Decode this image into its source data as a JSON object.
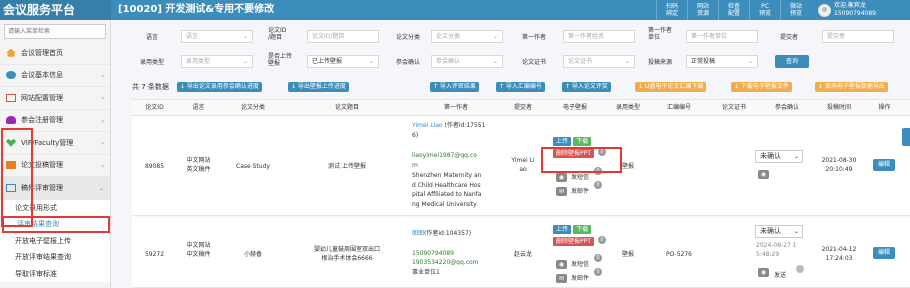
{
  "header": {
    "logo": "会议服务平台",
    "title": "[10020] 开发测试&专用不要修改",
    "buttons": [
      {
        "l1": "扫码",
        "l2": "绑定"
      },
      {
        "l1": "网站",
        "l2": "资源"
      },
      {
        "l1": "检查",
        "l2": "配置"
      },
      {
        "l1": "PC",
        "l2": "预览"
      },
      {
        "l1": "微站",
        "l2": "预览"
      }
    ],
    "user_greeting": "欢迎,衡宾龙",
    "user_phone": "15090794089"
  },
  "sidebar": {
    "search_placeholder": "请输入菜单检索",
    "items": [
      {
        "label": "会议管理首页",
        "color": "#e8a33d",
        "arrow": ""
      },
      {
        "label": "会议基本信息",
        "color": "#3c8dbc",
        "arrow": "‹"
      },
      {
        "label": "网站配置管理",
        "color": "#d9534f",
        "arrow": "‹"
      },
      {
        "label": "参会注册管理",
        "color": "#9c27b0",
        "arrow": "‹"
      },
      {
        "label": "VIP/Faculty管理",
        "color": "#4caf50",
        "arrow": "‹"
      },
      {
        "label": "论文投稿管理",
        "color": "#e67e22",
        "arrow": "‹"
      },
      {
        "label": "稿件评审管理",
        "color": "#3c8dbc",
        "arrow": "⌄"
      }
    ],
    "subitems": [
      "论文录用形式",
      "评审结果查询",
      "开放电子壁报上传",
      "开放评审结果查询",
      "导取评审标准"
    ]
  },
  "filters": {
    "row1": [
      {
        "label": "语言",
        "placeholder": "语言"
      },
      {
        "label": "论文ID\n/题目",
        "placeholder": "论文ID/题目"
      },
      {
        "label": "论文分类",
        "placeholder": "论文分类"
      },
      {
        "label": "第一作者",
        "placeholder": "第一作者姓名"
      },
      {
        "label": "第一作者\n单位",
        "placeholder": "第一作者单位"
      },
      {
        "label": "提交者",
        "placeholder": "提交者"
      }
    ],
    "row2": [
      {
        "label": "录用类型",
        "placeholder": "录用类型"
      },
      {
        "label": "是否上传\n壁报",
        "value": "已上传壁报"
      },
      {
        "label": "参会确认",
        "placeholder": "参会确认"
      },
      {
        "label": "论文证书",
        "placeholder": "论文证书"
      },
      {
        "label": "投稿来源",
        "value": "正常投稿"
      }
    ],
    "search_btn": "查询"
  },
  "toolbar": {
    "count": "共 7 条数据",
    "buttons": [
      {
        "label": "↓ 导出论文录用参会确认进度",
        "style": "blue"
      },
      {
        "label": "↓ 导出壁报上传进度",
        "style": "blue"
      },
      {
        "label": "↑ 导入评审结果",
        "style": "blue"
      },
      {
        "label": "↑ 导入汇编编号",
        "style": "blue"
      },
      {
        "label": "↑ 导入论文评奖",
        "style": "blue"
      },
      {
        "label": "↓ U盘电子论文汇编下载",
        "style": "orange"
      },
      {
        "label": "↓ 下载电子壁报文件",
        "style": "orange"
      },
      {
        "label": "↓ 现场电子壁报数据导出",
        "style": "orange"
      }
    ]
  },
  "table": {
    "headers": [
      "论文ID",
      "语言",
      "论文分类",
      "论文题目",
      "第一作者",
      "提交者",
      "电子壁报",
      "录用类型",
      "汇编编号",
      "论文证书",
      "参会确认",
      "投稿时间",
      "操作"
    ],
    "rows": [
      {
        "id": "89085",
        "lang": "中文网站\n英文稿件",
        "category": "Case Study",
        "title": "测试 上传壁报",
        "author_name": "Yimei Liao",
        "author_idnote": " (作者id:17551\n6)",
        "author_email": "liaoyimei1987@qq.co\nm",
        "author_org": "Shenzhen Maternity an\nd Child Healthcare Hos\npital Affiliated to Nanfa\nng Medical University",
        "submitter": "Yimei Li\nao",
        "upload": "上传",
        "download": "下载",
        "delete_poster": "删除壁报PPT",
        "send_sms": "发短信",
        "send_email": "发邮件",
        "sms_count": "0",
        "email_count": "0",
        "view_count": "0",
        "accept": "壁报",
        "compile": "",
        "confirm": "未确认",
        "time": "2021-08-30\n20:10:49",
        "edit": "编辑"
      },
      {
        "id": "59272",
        "lang": "中文网站\n中文稿件",
        "category": "小赫香",
        "title": "婴幼儿童鼓周围室双出口\n根治手术体会6666",
        "author_name": "图图",
        "author_idnote": "(作者id:104357)",
        "author_email": "15090794089\n1903534220@qq.com",
        "author_org": "事业单位1",
        "submitter": "赵云龙",
        "upload": "上传",
        "download": "下载",
        "delete_poster": "删除壁报PPT",
        "send_sms": "发短信",
        "send_email": "发邮件",
        "sms_count": "0",
        "email_count": "0",
        "view_count": "0",
        "accept": "壁报",
        "compile": "PO-5276",
        "confirm": "未确认",
        "confirm_time": "2024-08-27 1\n5:48:29",
        "send": "发送",
        "time": "2021-04-12\n17:24:03",
        "edit": "编辑"
      }
    ]
  }
}
